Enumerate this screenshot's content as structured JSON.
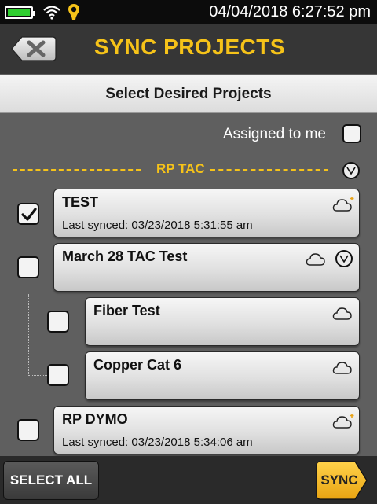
{
  "status_bar": {
    "datetime": "04/04/2018  6:27:52 pm",
    "battery_color": "#2fcf2f"
  },
  "header": {
    "title": "SYNC PROJECTS",
    "back_icon": "close-x-icon",
    "accent_color": "#f6c319"
  },
  "subheader": {
    "text": "Select Desired Projects"
  },
  "filter": {
    "assigned_label": "Assigned to me",
    "assigned_checked": false
  },
  "group": {
    "label": "RP TAC",
    "expand_icon": "chevron-down-icon"
  },
  "projects": [
    {
      "name": "TEST",
      "last_synced": "Last synced: 03/23/2018 5:31:55 am",
      "checked": true,
      "cloud_icon": "cloud-new-icon"
    },
    {
      "name": "March 28 TAC Test",
      "last_synced": "",
      "checked": false,
      "cloud_icon": "cloud-icon",
      "children": [
        {
          "name": "Fiber Test",
          "checked": false,
          "cloud_icon": "cloud-icon"
        },
        {
          "name": "Copper Cat 6",
          "checked": false,
          "cloud_icon": "cloud-icon"
        }
      ]
    },
    {
      "name": "RP DYMO",
      "last_synced": "Last synced: 03/23/2018 5:34:06 am",
      "checked": false,
      "cloud_icon": "cloud-new-icon"
    }
  ],
  "footer": {
    "select_all_label": "SELECT ALL",
    "sync_label": "SYNC"
  }
}
